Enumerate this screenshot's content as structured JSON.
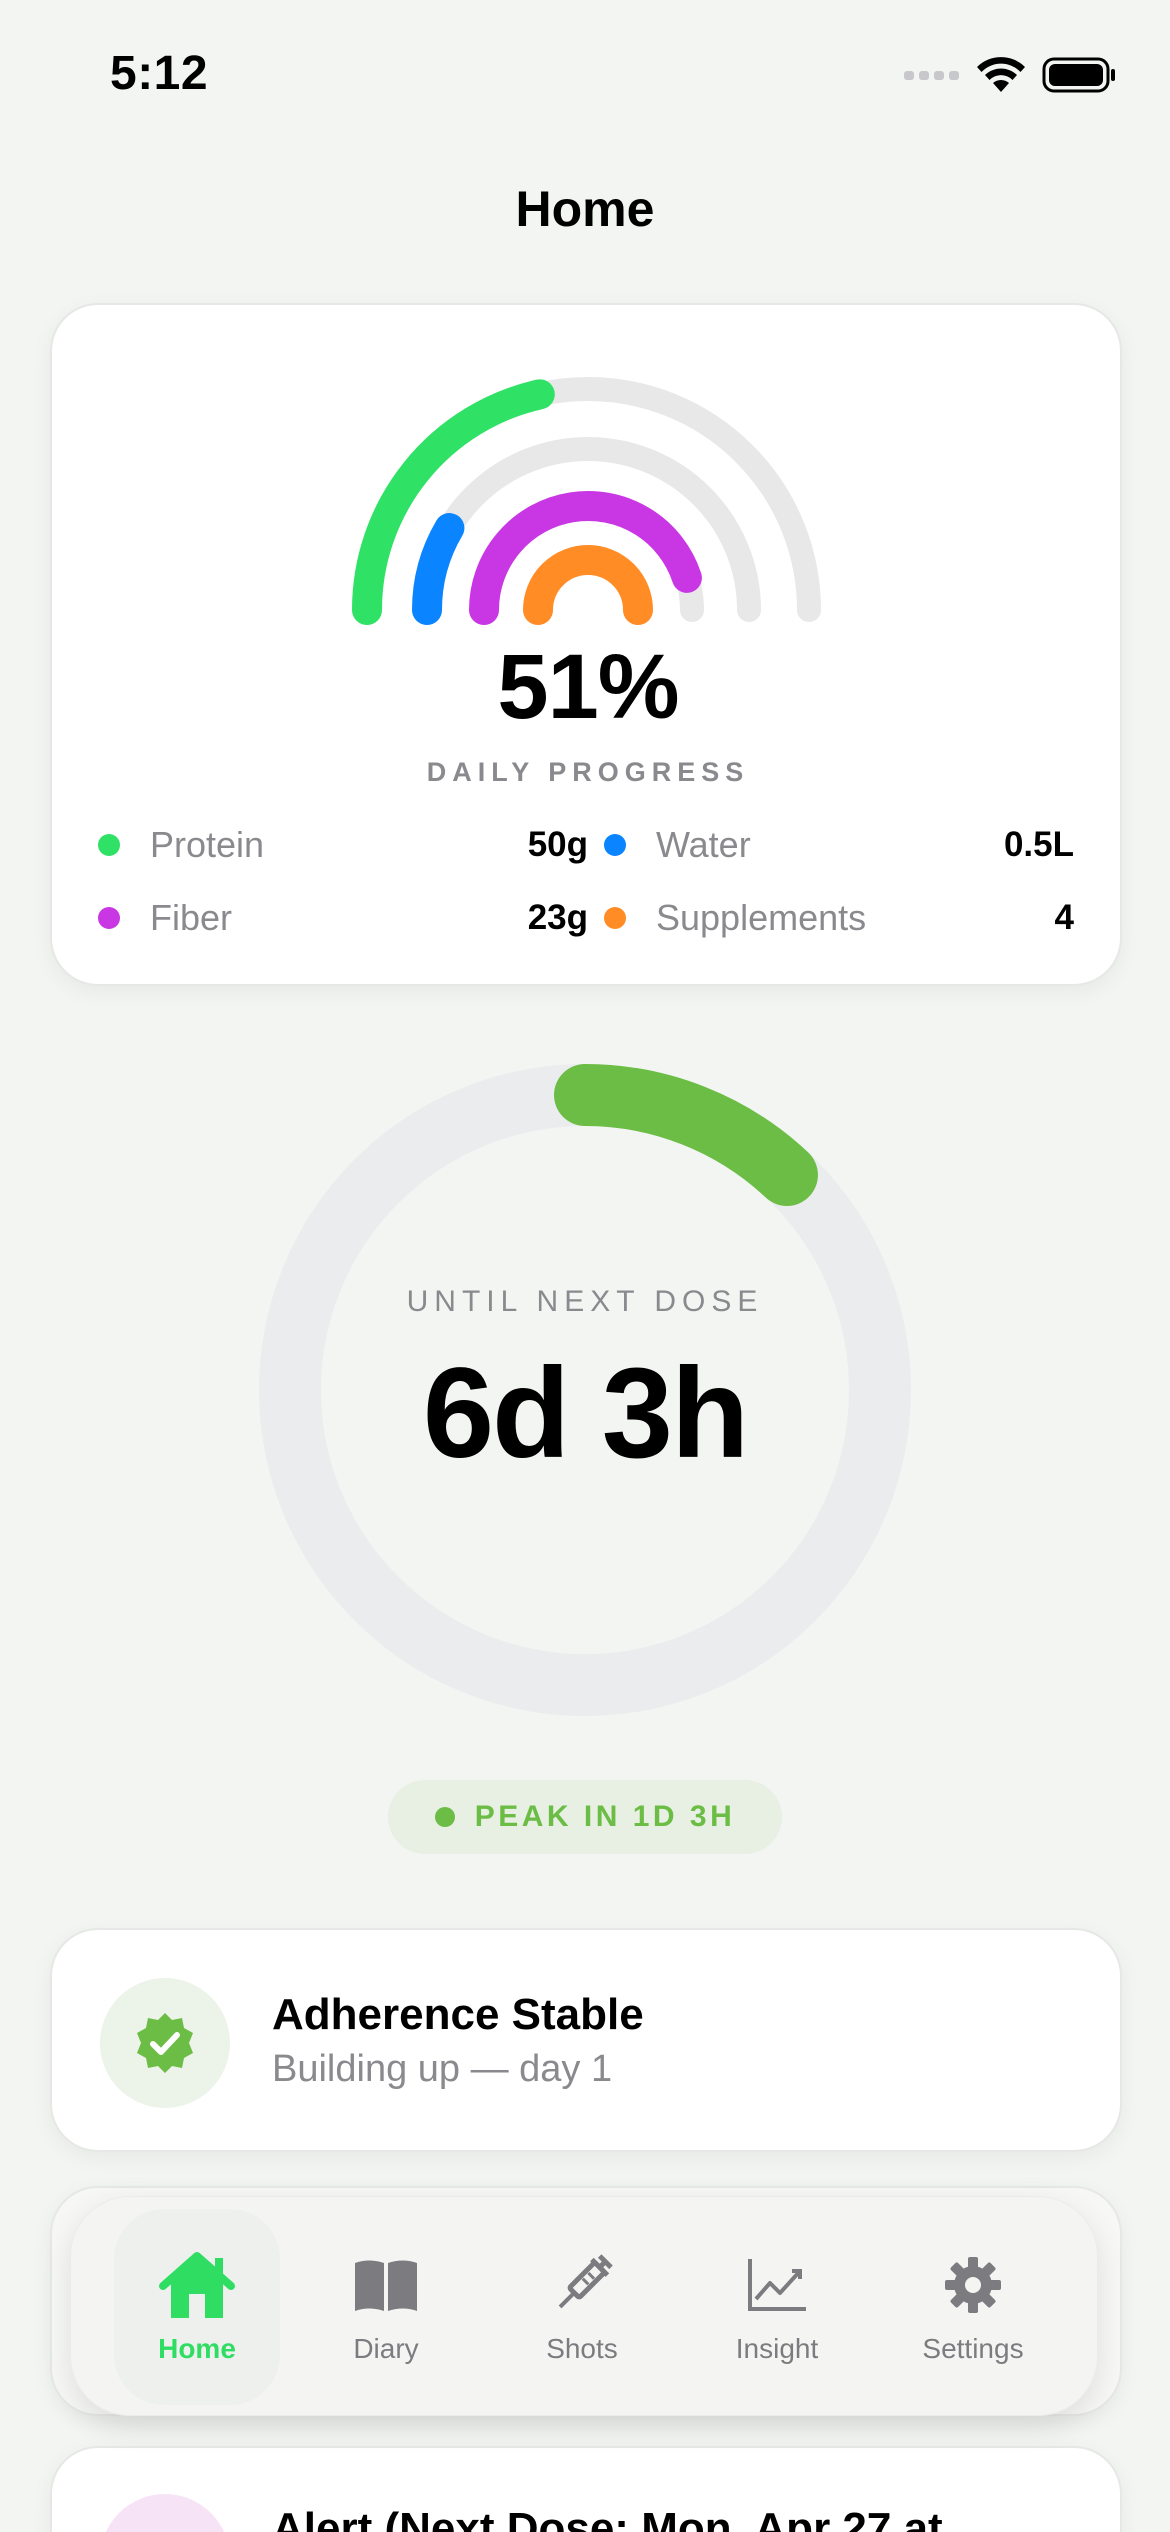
{
  "status_bar": {
    "time": "5:12"
  },
  "nav": {
    "title": "Home"
  },
  "progress": {
    "percent": "51%",
    "label": "DAILY PROGRESS",
    "legend": [
      {
        "name": "Protein",
        "value": "50g",
        "color": "#2fe165"
      },
      {
        "name": "Water",
        "value": "0.5L",
        "color": "#0a84ff"
      },
      {
        "name": "Fiber",
        "value": "23g",
        "color": "#c936e3"
      },
      {
        "name": "Supplements",
        "value": "4",
        "color": "#ff8c25"
      }
    ],
    "ring_track_color": "#e8e8e8",
    "ring_fractions": [
      0.43,
      0.17,
      0.9,
      1.0
    ]
  },
  "dose": {
    "label": "UNTIL NEXT DOSE",
    "value": "6d 3h",
    "ring_fraction": 0.12,
    "ring_color": "#6cbd45",
    "track_color": "#ebecee"
  },
  "peak": {
    "text": "PEAK IN 1D 3H"
  },
  "adherence": {
    "title": "Adherence Stable",
    "subtitle": "Building up — day 1"
  },
  "tabs": [
    {
      "label": "Home",
      "icon": "house-icon",
      "active": true
    },
    {
      "label": "Diary",
      "icon": "book-icon",
      "active": false
    },
    {
      "label": "Shots",
      "icon": "syringe-icon",
      "active": false
    },
    {
      "label": "Insight",
      "icon": "chart-line-icon",
      "active": false
    },
    {
      "label": "Settings",
      "icon": "gear-icon",
      "active": false
    }
  ],
  "alert": {
    "title": "Alert (Next Dose: Mon, Apr 27 at"
  },
  "colors": {
    "accent_green": "#2fdd63",
    "dose_green": "#6cbd45",
    "muted_text": "#8a8a8e"
  }
}
